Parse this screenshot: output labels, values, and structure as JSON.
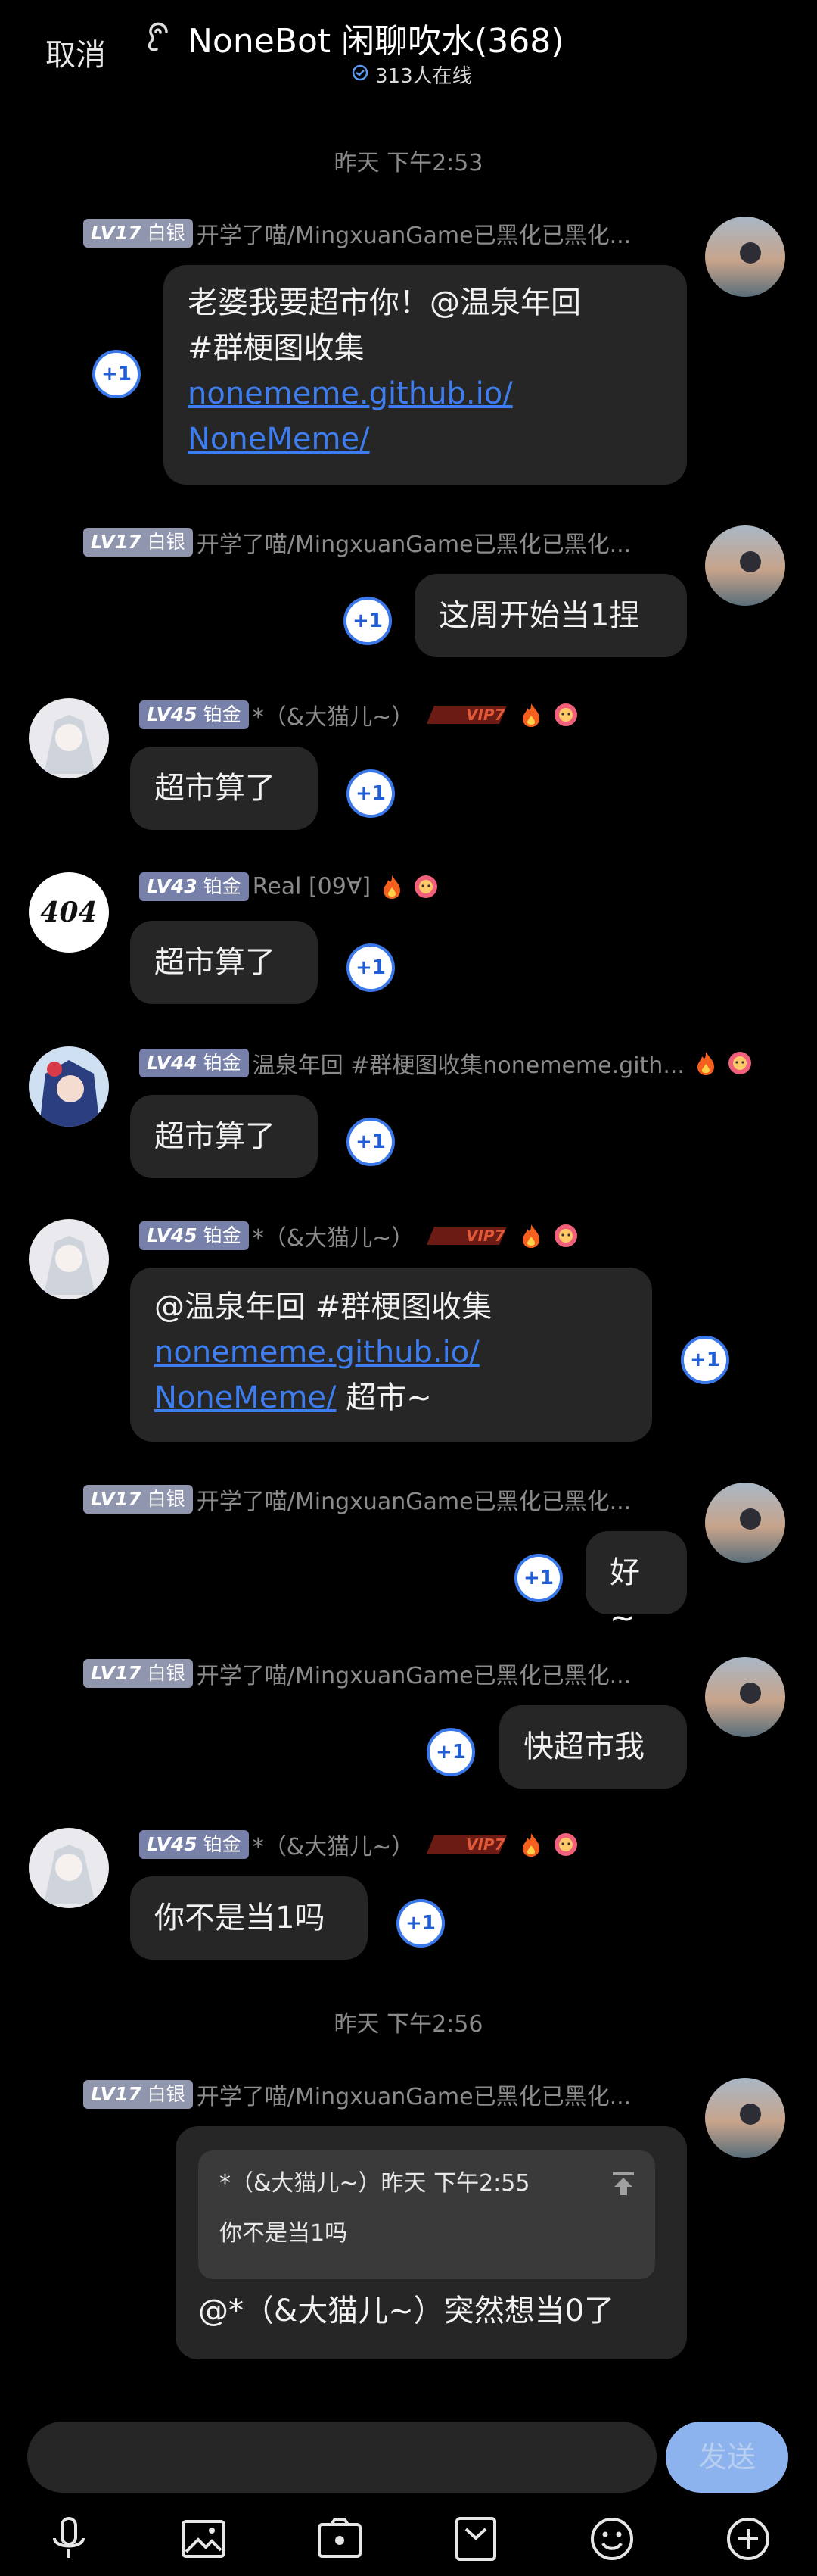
{
  "header": {
    "cancel": "取消",
    "title": "NoneBot 闲聊吹水(368)",
    "online": "313人在线"
  },
  "timestamps": [
    "昨天 下午2:53",
    "昨天 下午2:56"
  ],
  "badges": {
    "silver": {
      "lv": "LV17",
      "tier": "白银"
    },
    "l45": {
      "lv": "LV45",
      "tier": "铂金"
    },
    "l43": {
      "lv": "LV43",
      "tier": "铂金"
    },
    "l44": {
      "lv": "LV44",
      "tier": "铂金"
    }
  },
  "names": {
    "me": "开学了喵/MingxuanGame已黑化已黑化...",
    "cat": "*（&大猫儿~）",
    "real": "Real [09∀]",
    "wen": "温泉年回 #群梗图收集nonememe.gith..."
  },
  "vip_label": "VIP7",
  "avatar_404": "404",
  "plus_label": "+1",
  "messages": {
    "m1": {
      "l1": "老婆我要超市你！@温泉年回",
      "l2": "#群梗图收集",
      "link1": "nonememe.github.io/",
      "link2": "NoneMeme/"
    },
    "m2": "这周开始当1捏",
    "m3": "超市算了",
    "m4": "超市算了",
    "m5": "超市算了",
    "m6": {
      "l1": "@温泉年回 #群梗图收集",
      "link1": "nonememe.github.io/",
      "link2": "NoneMeme/",
      "tail": " 超市~"
    },
    "m7": "好~",
    "m8": "快超市我",
    "m9": "你不是当1吗",
    "m10": {
      "quote_head": "*（&大猫儿~）昨天 下午2:55",
      "quote_text": "你不是当1吗",
      "text": "@*（&大猫儿~）突然想当0了"
    }
  },
  "composer": {
    "send": "发送"
  },
  "toolbar": [
    "mic-icon",
    "image-icon",
    "camera-icon",
    "file-icon",
    "emoji-icon",
    "plus-icon"
  ]
}
